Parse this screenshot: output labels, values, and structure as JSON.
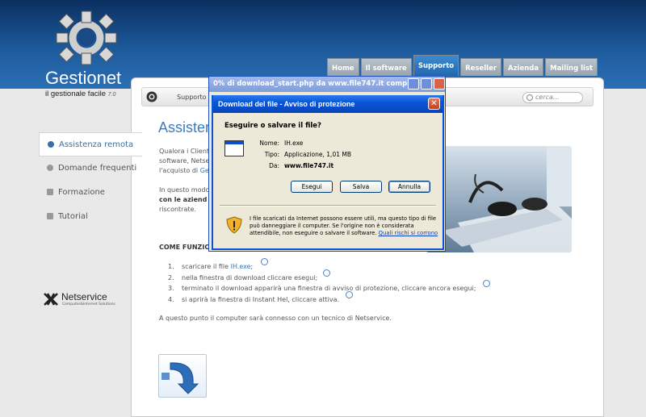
{
  "brand": {
    "name": "Gestionet",
    "tagline": "il gestionale facile",
    "version": "7.0"
  },
  "nav": {
    "tabs": [
      {
        "label": "Home"
      },
      {
        "label": "Il software"
      },
      {
        "label": "Supporto"
      },
      {
        "label": "Reseller"
      },
      {
        "label": "Azienda"
      },
      {
        "label": "Mailing list"
      }
    ],
    "active": "Supporto"
  },
  "breadcrumb": "Supporto",
  "search": {
    "placeholder": "cerca..."
  },
  "sidebar": {
    "items": [
      {
        "label": "Assistenza remota"
      },
      {
        "label": "Domande frequenti"
      },
      {
        "label": "Formazione"
      },
      {
        "label": "Tutorial"
      }
    ]
  },
  "partner": {
    "name": "Netservice",
    "sub": "Computer&Internet Solutions"
  },
  "main": {
    "title": "Assister",
    "para1": {
      "l1": "Qualora i Client",
      "l2": "software,  Netse",
      "l3a": "l'acquisto di ",
      "l3b": "Ge"
    },
    "para2": {
      "l1": "In questo modo",
      "l2": "con le aziend",
      "l3": "riscontrate."
    },
    "section": "COME FUNZION",
    "steps": [
      {
        "n": "1.",
        "pre": "scaricare il file ",
        "link": "IH.exe",
        "post": ";"
      },
      {
        "n": "2.",
        "pre": "nella finestra di download cliccare esegui;",
        "link": "",
        "post": ""
      },
      {
        "n": "3.",
        "pre": "terminato il download apparirà una finestra di avviso di protezione, cliccare ancora esegui;",
        "link": "",
        "post": ""
      },
      {
        "n": "4.",
        "pre": "si aprirà la finestra di Instant Hel, cliccare attiva.",
        "link": "",
        "post": ""
      }
    ],
    "closing": "A questo punto il computer  sarà connesso con un tecnico di Netservice."
  },
  "browser_window": {
    "title": "0% di download_start.php da www.file747.it compl..."
  },
  "dialog": {
    "title": "Download del file - Avviso di protezione",
    "question": "Eseguire o salvare il file?",
    "labels": {
      "name": "Nome:",
      "type": "Tipo:",
      "from": "Da:"
    },
    "values": {
      "name": "IH.exe",
      "type": "Applicazione, 1,01 MB",
      "from": "www.file747.it"
    },
    "buttons": {
      "run": "Esegui",
      "save": "Salva",
      "cancel": "Annulla"
    },
    "warning": "I file scaricati da Internet possono essere utili, ma questo tipo di file può danneggiare il computer. Se l'origine non è considerata attendibile, non eseguire o salvare il software. ",
    "warning_link": "Quali rischi si corrono"
  }
}
